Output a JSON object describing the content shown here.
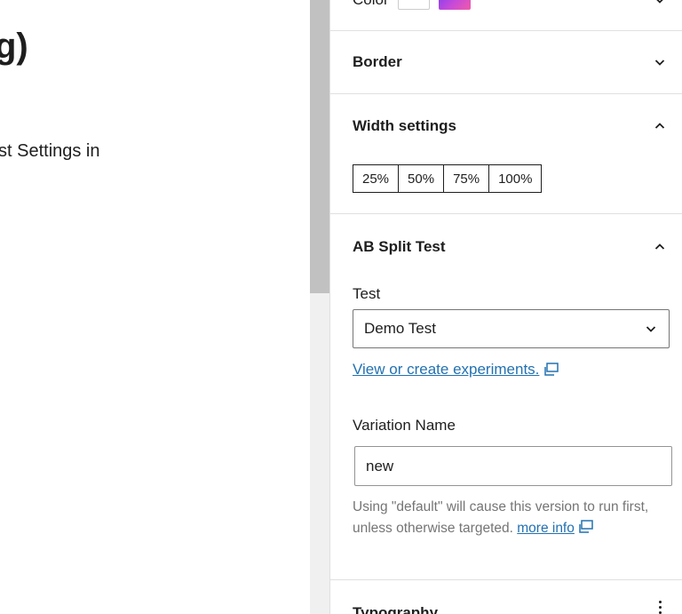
{
  "canvas": {
    "heading": "g)",
    "paragraph": "st Settings in"
  },
  "sidebar": {
    "color_panel": {
      "title": "Color",
      "swatches": [
        "#ffffff",
        "linear-gradient purple to pink"
      ]
    },
    "border_panel": {
      "title": "Border"
    },
    "width_panel": {
      "title": "Width settings",
      "options": [
        "25%",
        "50%",
        "75%",
        "100%"
      ]
    },
    "ab_panel": {
      "title": "AB Split Test",
      "test_label": "Test",
      "test_selected": "Demo Test",
      "experiments_link": "View or create experiments.",
      "variation_label": "Variation Name",
      "variation_value": "new",
      "help_text": "Using \"default\" will cause this version to run first, unless otherwise targeted.",
      "help_link": "more info"
    },
    "typography_panel": {
      "title": "Typography"
    }
  },
  "icons": {
    "chevron_down": "chevron-down-icon",
    "chevron_up": "chevron-up-icon",
    "external": "external-link-icon",
    "more": "more-vertical-icon"
  },
  "colors": {
    "link": "#2271b1",
    "text": "#1e1e1e",
    "muted": "#757575",
    "divider": "#e0e0e0"
  }
}
